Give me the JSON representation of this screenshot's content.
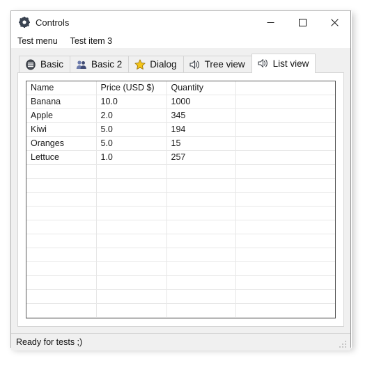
{
  "window": {
    "title": "Controls",
    "icon": "gear-icon",
    "controls": {
      "minimize": "minimize-icon",
      "maximize": "maximize-icon",
      "close": "close-icon"
    }
  },
  "menubar": {
    "items": [
      {
        "label": "Test menu"
      },
      {
        "label": "Test item 3"
      }
    ]
  },
  "tabs": [
    {
      "label": "Basic",
      "icon": "disc-menu-icon",
      "active": false
    },
    {
      "label": "Basic 2",
      "icon": "users-icon",
      "active": false
    },
    {
      "label": "Dialog",
      "icon": "star-icon",
      "active": false
    },
    {
      "label": "Tree view",
      "icon": "speaker-icon",
      "active": false
    },
    {
      "label": "List view",
      "icon": "speaker-icon",
      "active": true
    }
  ],
  "listview": {
    "columns": [
      "Name",
      "Price (USD $)",
      "Quantity",
      ""
    ],
    "rows": [
      [
        "Banana",
        "10.0",
        "1000",
        ""
      ],
      [
        "Apple",
        "2.0",
        "345",
        ""
      ],
      [
        "Kiwi",
        "5.0",
        "194",
        ""
      ],
      [
        "Oranges",
        "5.0",
        "15",
        ""
      ],
      [
        "Lettuce",
        "1.0",
        "257",
        ""
      ]
    ],
    "empty_row_count": 11
  },
  "statusbar": {
    "text": "Ready for tests ;)",
    "grip": "resize-grip-icon"
  },
  "colors": {
    "window_border": "#b0b0b0",
    "panel_bg": "#f0f0f0",
    "content_bg": "#ffffff",
    "tab_border": "#d4d4d4",
    "grid_border": "#5a5a5a",
    "star_gold": "#f5c518",
    "user_blue": "#5b6a9e",
    "icon_dark": "#3b4452"
  }
}
